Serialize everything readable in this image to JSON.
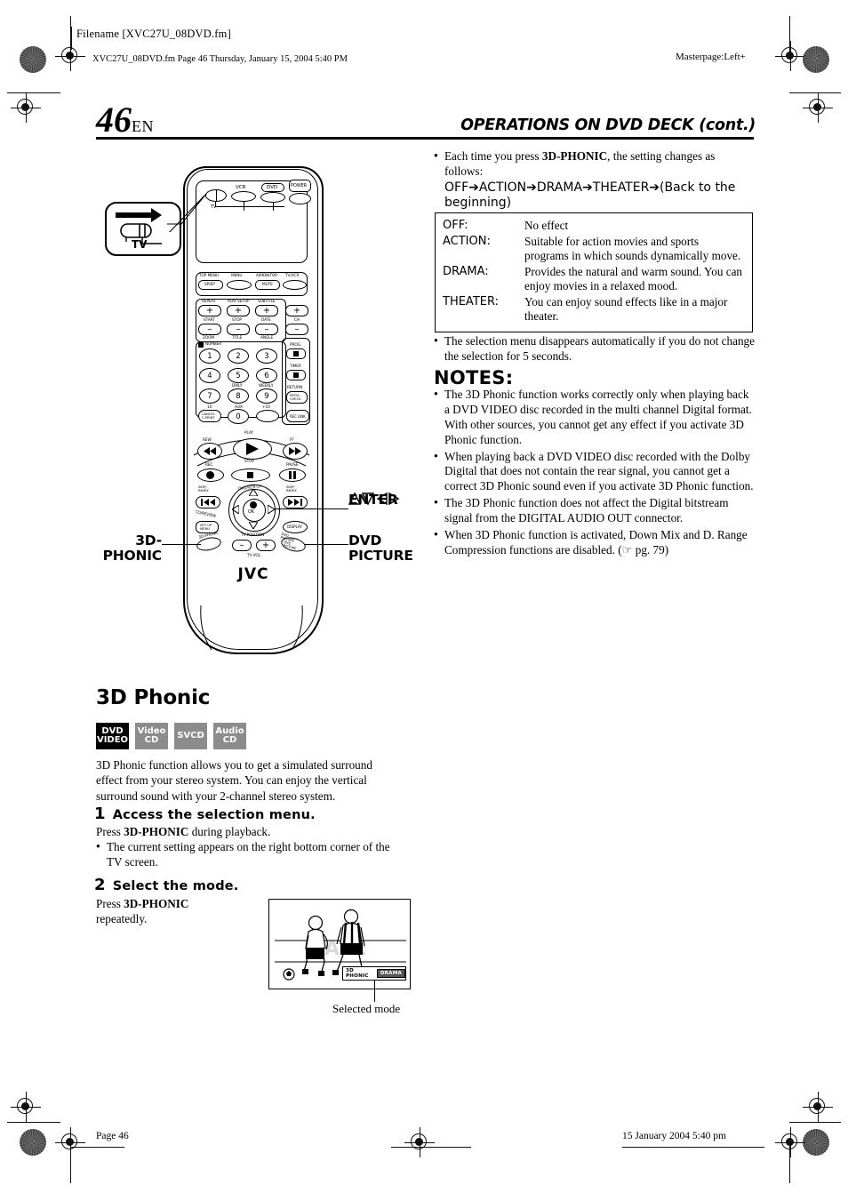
{
  "slug": {
    "filename": "Filename [XVC27U_08DVD.fm]",
    "fm_line": "XVC27U_08DVD.fm  Page 46  Thursday, January 15, 2004  5:40 PM",
    "masterpage": "Masterpage:Left+"
  },
  "header": {
    "page_number": "46",
    "lang": "EN",
    "title": "OPERATIONS ON DVD DECK (cont.)"
  },
  "right_column": {
    "intro_bullet_1": "Each time you press ",
    "intro_bullet_1_bold": "3D-PHONIC",
    "intro_bullet_1_rest": ", the setting changes as follows:",
    "sequence": "OFF➔ACTION➔DRAMA➔THEATER➔(Back to the beginning)",
    "modes": [
      {
        "name": "OFF:",
        "desc": "No effect"
      },
      {
        "name": "ACTION:",
        "desc": "Suitable for action movies and sports programs in which sounds dynamically move."
      },
      {
        "name": "DRAMA:",
        "desc": "Provides the natural and warm sound. You can enjoy movies in a relaxed mood."
      },
      {
        "name": "THEATER:",
        "desc": "You can enjoy sound effects like in a major theater."
      }
    ],
    "after_table_bullet": "The selection menu disappears automatically if you do not change the selection for 5 seconds.",
    "notes_heading": "NOTES:",
    "notes": [
      "The 3D Phonic function works correctly only when playing back a DVD VIDEO disc recorded in the multi channel Digital format. With other sources, you cannot get any effect if you activate 3D Phonic function.",
      "When playing back a DVD VIDEO disc recorded with the Dolby Digital that does not contain the rear signal, you cannot get a correct 3D Phonic sound even if you activate 3D Phonic function.",
      "The 3D Phonic function does not affect the Digital bitstream signal from the DIGITAL AUDIO OUT connector.",
      "When 3D Phonic function is activated, Down Mix and D. Range Compression functions are disabled. (☞ pg. 79)"
    ]
  },
  "remote": {
    "callouts": {
      "tv_switch": "TV",
      "enter_arrows": "△▽◁▷",
      "enter": "ENTER",
      "three_d_phonic_l1": "3D-",
      "three_d_phonic_l2": "PHONIC",
      "dvd_picture_l1": "DVD",
      "dvd_picture_l2": "PICTURE"
    },
    "top_row": {
      "vcr": "VCR",
      "dvd": "DVD",
      "power": "POWER",
      "tv": "TV"
    },
    "menu_row": [
      {
        "top": "TOP MENU",
        "btn": "SP/EP"
      },
      {
        "top": "MENU",
        "btn": ""
      },
      {
        "top": "A/MONITOR",
        "btn": "MUTE"
      },
      {
        "top": "TV/VCR",
        "btn": ""
      }
    ],
    "plusminus": [
      {
        "plus_lbl": "REPEAT",
        "minus_lbl": "START",
        "under": "ZOOM"
      },
      {
        "plus_lbl": "PLAY SETUP",
        "minus_lbl": "STOP",
        "under": "TITLE"
      },
      {
        "plus_lbl": "SUBTITLE",
        "minus_lbl": "DATE",
        "under": "ANGLE"
      },
      {
        "plus_lbl": "",
        "minus_lbl": "CH",
        "under": ""
      }
    ],
    "number_label": "NUMBER",
    "numbers": [
      "1",
      "2",
      "3",
      "4",
      "5",
      "6",
      "7",
      "8",
      "9",
      "0"
    ],
    "number_subs": {
      "eight": "DAILY",
      "nine": "WEEKLY",
      "ten": "10",
      "zero_top": "AUX",
      "plus10": "+10"
    },
    "side_buttons": [
      {
        "top": "PROG.",
        "label": "■"
      },
      {
        "top": "TIMER",
        "label": "■"
      },
      {
        "top": "RETURN",
        "label": "PROG. CHECK"
      }
    ],
    "cancel": "CANCEL C-PRINT",
    "reclink": "REC LINK",
    "transport": {
      "rew": "REW",
      "play": "PLAY",
      "ff": "FF",
      "rec": "REC",
      "stop": "STOP",
      "pause": "PAUSE",
      "skip_back": "SKIP/ INDEX",
      "skip_fwd": "SKIP/ INDEX",
      "ok": "OK",
      "dvd_vcr_ch": "DVD/VCR CH",
      "tv_position": "TV POSITION",
      "setup_menu": "SET UP MENU",
      "display": "DISPLAY",
      "cd_review": "CD/REVIEW",
      "three_d_phonic": "3D-PHONIC",
      "dvd_picture": "DVD PICTURE",
      "tv_vol": "TV VOL",
      "minus": "–",
      "plus": "+"
    },
    "brand": "JVC"
  },
  "left_column": {
    "section_title": "3D Phonic",
    "badges": [
      {
        "l1": "DVD",
        "l2": "VIDEO",
        "style": "dark"
      },
      {
        "l1": "Video",
        "l2": "CD",
        "style": "gray"
      },
      {
        "l1": "SVCD",
        "l2": "",
        "style": "gray"
      },
      {
        "l1": "Audio",
        "l2": "CD",
        "style": "gray"
      }
    ],
    "description": "3D Phonic function allows you to get a simulated surround effect from your stereo system. You can enjoy the vertical surround sound with your 2-channel stereo system.",
    "steps": [
      {
        "num": "1",
        "title": "Access the selection menu.",
        "line1_pre": "Press ",
        "line1_bold": "3D-PHONIC",
        "line1_post": " during playback.",
        "bullet": "The current setting appears on the right bottom corner of the TV screen."
      },
      {
        "num": "2",
        "title": "Select the mode.",
        "line1_pre": "Press ",
        "line1_bold": "3D-PHONIC",
        "line1_post": "",
        "line2": "repeatedly."
      }
    ],
    "tv_osd": {
      "label": "3D PHONIC",
      "value": "DRAMA"
    },
    "caption": "Selected mode"
  },
  "footer": {
    "page": "Page 46",
    "timestamp": "15 January 2004 5:40 pm"
  },
  "colors": {
    "ink": "#000000",
    "badge_gray": "#8c8c8c",
    "osd_highlight": "#555555"
  }
}
